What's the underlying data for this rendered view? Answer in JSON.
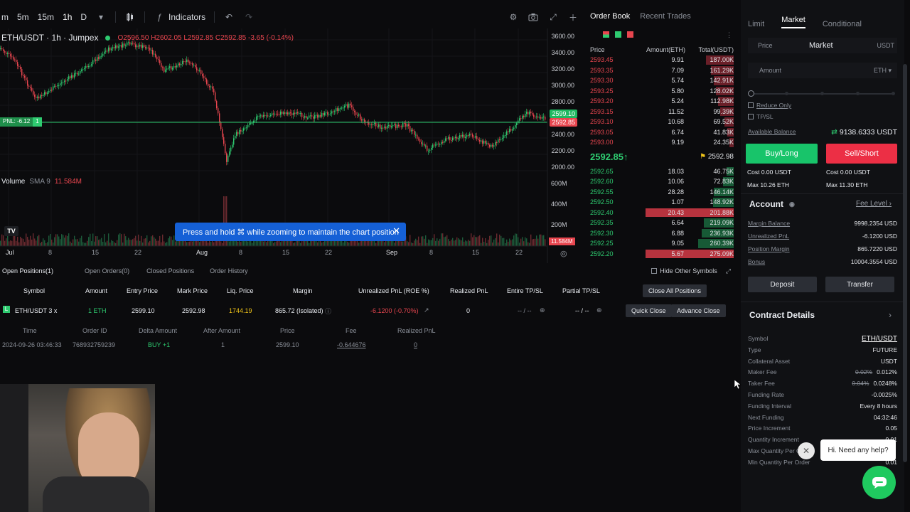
{
  "toolbar": {
    "timeframes": [
      "m",
      "5m",
      "15m",
      "1h",
      "D"
    ],
    "active_timeframe": "1h",
    "indicators_label": "Indicators"
  },
  "legend": {
    "symbol": "ETH/USDT · 1h · Jumpex",
    "open": "O2596.50",
    "high": "H2602.05",
    "low": "L2592.85",
    "close": "C2592.85",
    "change": "-3.65 (-0.14%)"
  },
  "chart": {
    "price_labels": [
      "3600.00",
      "3400.00",
      "3200.00",
      "3000.00",
      "2800.00",
      "2600.00",
      "2400.00",
      "2200.00",
      "2000.00"
    ],
    "price_tag_green": "2599.10",
    "price_tag_red": "2592.85",
    "pnl_tag": "PNL: -6.12",
    "pnl_tag_qty": "1",
    "volume_label": "Volume",
    "volume_sma": "SMA 9",
    "volume_value": "11.584M",
    "volume_axis": [
      "600M",
      "400M",
      "200M"
    ],
    "volume_tag": "11.584M",
    "x_labels": [
      "Jul",
      "8",
      "15",
      "22",
      "Aug",
      "8",
      "15",
      "22",
      "Sep",
      "8",
      "15",
      "22"
    ],
    "colors": {
      "up": "#2ecb70",
      "down": "#e8464f"
    }
  },
  "toast": {
    "message": "Press and hold ⌘ while zooming to maintain the chart position"
  },
  "orderbook": {
    "tabs": [
      "Order Book",
      "Recent Trades"
    ],
    "headers": [
      "Price",
      "Amount(ETH)",
      "Total(USDT)"
    ],
    "asks": [
      {
        "price": "2593.45",
        "amount": "9.91",
        "total": "187.00K",
        "depth": 0.27
      },
      {
        "price": "2593.35",
        "amount": "7.09",
        "total": "161.29K",
        "depth": 0.22
      },
      {
        "price": "2593.30",
        "amount": "5.74",
        "total": "142.91K",
        "depth": 0.19
      },
      {
        "price": "2593.25",
        "amount": "5.80",
        "total": "128.02K",
        "depth": 0.17
      },
      {
        "price": "2593.20",
        "amount": "5.24",
        "total": "112.98K",
        "depth": 0.15
      },
      {
        "price": "2593.15",
        "amount": "11.52",
        "total": "99.39K",
        "depth": 0.13
      },
      {
        "price": "2593.10",
        "amount": "10.68",
        "total": "69.52K",
        "depth": 0.09
      },
      {
        "price": "2593.05",
        "amount": "6.74",
        "total": "41.83K",
        "depth": 0.06
      },
      {
        "price": "2593.00",
        "amount": "9.19",
        "total": "24.35K",
        "depth": 0.04
      }
    ],
    "mid_price": "2592.85",
    "mid_arrow": "↑",
    "mark_price": "2592.98",
    "bids": [
      {
        "price": "2592.65",
        "amount": "18.03",
        "total": "46.75K",
        "depth": 0.07
      },
      {
        "price": "2592.60",
        "amount": "10.06",
        "total": "72.83K",
        "depth": 0.1
      },
      {
        "price": "2592.55",
        "amount": "28.28",
        "total": "146.14K",
        "depth": 0.19
      },
      {
        "price": "2592.50",
        "amount": "1.07",
        "total": "148.92K",
        "depth": 0.2
      },
      {
        "price": "2592.40",
        "amount": "20.43",
        "total": "201.88K",
        "depth": 0.85,
        "highlight": true
      },
      {
        "price": "2592.35",
        "amount": "6.64",
        "total": "219.09K",
        "depth": 0.29
      },
      {
        "price": "2592.30",
        "amount": "6.88",
        "total": "236.93K",
        "depth": 0.31
      },
      {
        "price": "2592.25",
        "amount": "9.05",
        "total": "260.39K",
        "depth": 0.34
      },
      {
        "price": "2592.20",
        "amount": "5.67",
        "total": "275.09K",
        "depth": 0.85,
        "highlight": true
      }
    ]
  },
  "positions": {
    "tabs": [
      "Open Positions(1)",
      "Open Orders(0)",
      "Closed Positions",
      "Order History"
    ],
    "hide_other": "Hide Other Symbols",
    "headers": [
      "Symbol",
      "Amount",
      "Entry Price",
      "Mark Price",
      "Liq. Price",
      "Margin",
      "Unrealized PnL (ROE %)",
      "Realized PnL",
      "Entire TP/SL",
      "Partial TP/SL"
    ],
    "close_all": "Close All Positions",
    "row": {
      "symbol": "ETH/USDT 3 x",
      "amount": "1 ETH",
      "entry": "2599.10",
      "mark": "2592.98",
      "liq": "1744.19",
      "margin": "865.72 (Isolated)",
      "upnl": "-6.1200 (-0.70%)",
      "rpnl": "0",
      "entire_tpsl": "-- / --",
      "partial_tpsl": "-- / --",
      "quick_close": "Quick Close",
      "advance_close": "Advance Close"
    },
    "sub_headers": [
      "Time",
      "Order ID",
      "Delta Amount",
      "After Amount",
      "Price",
      "Fee",
      "Realized PnL"
    ],
    "sub_row": {
      "time": "2024-09-26 03:46:33",
      "order_id": "768932759239",
      "delta": "BUY +1",
      "after": "1",
      "price": "2599.10",
      "fee": "-0.644676",
      "rpnl": "0"
    }
  },
  "right_panel": {
    "order_tabs": [
      "Limit",
      "Market",
      "Conditional"
    ],
    "active_tab": "Market",
    "price_label": "Price",
    "price_value": "Market",
    "price_unit": "USDT",
    "amount_placeholder": "Amount",
    "amount_unit": "ETH",
    "reduce_only": "Reduce Only",
    "tpsl": "TP/SL",
    "available_balance_label": "Available Balance",
    "available_balance": "9138.6333 USDT",
    "buy_label": "Buy/Long",
    "sell_label": "Sell/Short",
    "buy_cost": "Cost 0.00 USDT",
    "buy_max": "Max  10.26 ETH",
    "sell_cost": "Cost 0.00 USDT",
    "sell_max": "Max  11.30 ETH",
    "account_title": "Account",
    "fee_level": "Fee Level",
    "account": [
      {
        "k": "Margin Balance",
        "v": "9998.2354 USD"
      },
      {
        "k": "Unrealized PnL",
        "v": "-6.1200 USD",
        "red": true
      },
      {
        "k": "Position Margin",
        "v": "865.7220 USD"
      },
      {
        "k": "Bonus",
        "v": "10004.3554 USD"
      }
    ],
    "deposit": "Deposit",
    "transfer": "Transfer",
    "contract_title": "Contract Details",
    "contract": [
      {
        "k": "Symbol",
        "v": "ETH/USDT"
      },
      {
        "k": "Type",
        "v": "FUTURE"
      },
      {
        "k": "Collateral Asset",
        "v": "USDT"
      },
      {
        "k": "Maker Fee",
        "v_old": "0.02%",
        "v": "0.012%"
      },
      {
        "k": "Taker Fee",
        "v_old": "0.04%",
        "v": "0.0248%"
      },
      {
        "k": "Funding Rate",
        "v": "-0.0025%"
      },
      {
        "k": "Funding Interval",
        "v": "Every 8 hours"
      },
      {
        "k": "Next Funding",
        "v": "04:32:46"
      },
      {
        "k": "Price Increment",
        "v": "0.05"
      },
      {
        "k": "Quantity Increment",
        "v": "0.01"
      },
      {
        "k": "Max Quantity Per Order",
        "v": ""
      },
      {
        "k": "Min Quantity Per Order",
        "v": "0.01"
      }
    ]
  },
  "help": {
    "message": "Hi. Need any help?"
  }
}
